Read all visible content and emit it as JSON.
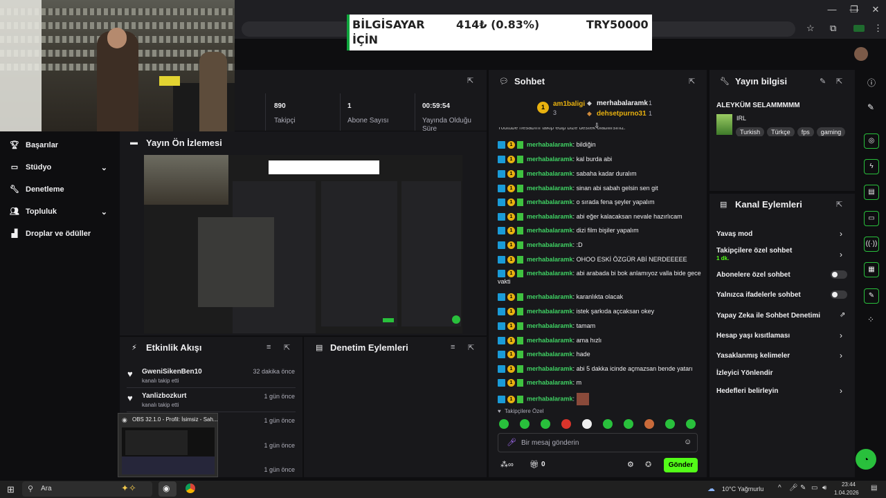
{
  "ticker": {
    "label": "BİLGİSAYAR İÇİN",
    "value": "414₺ (0.83%)",
    "target": "TRY50000"
  },
  "stats": [
    {
      "value": "890",
      "label": "Takipçi"
    },
    {
      "value": "1",
      "label": "Abone Sayısı"
    },
    {
      "value": "00:59:54",
      "label": "Yayında Olduğu Süre"
    }
  ],
  "sidebar": {
    "items": [
      {
        "label": "Başarılar",
        "icon": "trophy-icon"
      },
      {
        "label": "Stüdyo",
        "icon": "studio-icon"
      },
      {
        "label": "Denetleme",
        "icon": "wrench-icon"
      },
      {
        "label": "Topluluk",
        "icon": "community-icon"
      },
      {
        "label": "Droplar ve ödüller",
        "icon": "drops-icon"
      }
    ]
  },
  "preview": {
    "title": "Yayın Ön İzlemesi"
  },
  "events": {
    "title": "Etkinlik Akışı",
    "items": [
      {
        "name": "GweniSikenBen10",
        "action": "kanalı takip etti",
        "time": "32 dakika önce"
      },
      {
        "name": "Yanlizbozkurt",
        "action": "kanalı takip etti",
        "time": "1 gün önce"
      },
      {
        "time": "1 gün önce"
      },
      {
        "time": "1 gün önce"
      },
      {
        "time": "1 gün önce"
      }
    ]
  },
  "moderation": {
    "title": "Denetim Eylemleri"
  },
  "obs_popup": {
    "title": "OBS 32.1.0 - Profil: İsimsiz - Sah..."
  },
  "chat": {
    "title": "Sohbet",
    "leaderboard": [
      {
        "rank": "1",
        "name": "am1baligi",
        "count": "3"
      },
      {
        "name": "merhabalaramk",
        "count": "1"
      },
      {
        "name": "dehsetpurno31",
        "count": "1"
      }
    ],
    "truncated_top": "Youtube hesabını takip edip bize destek olabilirsiniz.",
    "messages": [
      {
        "user": "merhabalaramk",
        "text": "bildiğin"
      },
      {
        "user": "merhabalaramk",
        "text": "kal burda abi"
      },
      {
        "user": "merhabalaramk",
        "text": "sabaha kadar duralım"
      },
      {
        "user": "merhabalaramk",
        "text": "sinan abi sabah gelsin sen git"
      },
      {
        "user": "merhabalaramk",
        "text": "o sırada fena şeyler yapalım"
      },
      {
        "user": "merhabalaramk",
        "text": "abi eğer kalacaksan nevale hazırlıcam"
      },
      {
        "user": "merhabalaramk",
        "text": "dizi film bişiler yapalım"
      },
      {
        "user": "merhabalaramk",
        "text": ":D"
      },
      {
        "user": "merhabalaramk",
        "text": "OHOO ESKİ ÖZGÜR ABİ NERDEEEEE"
      },
      {
        "user": "merhabalaramk",
        "text": "abi arabada bi bok anlamıyoz valla bide gece vakti"
      },
      {
        "user": "merhabalaramk",
        "text": "karanlıkta olacak"
      },
      {
        "user": "merhabalaramk",
        "text": "istek şarkıda açcaksan okey"
      },
      {
        "user": "merhabalaramk",
        "text": "tamam"
      },
      {
        "user": "merhabalaramk",
        "text": "ama hızlı"
      },
      {
        "user": "merhabalaramk",
        "text": "hade"
      },
      {
        "user": "merhabalaramk",
        "text": "abi 5 dakka icinde açmazsan bende yatarı"
      },
      {
        "user": "merhabalaramk",
        "text": "m"
      },
      {
        "user": "merhabalaramk",
        "text": ""
      }
    ],
    "followers_only": "Takipçilere Özel",
    "input_placeholder": "Bir mesaj gönderin",
    "points": "0",
    "send_label": "Gönder"
  },
  "stream_info": {
    "title": "Yayın bilgisi",
    "stream_title": "ALEYKÜM SELAMMMMM",
    "category": "IRL",
    "tags": [
      "Turkish",
      "Türkçe",
      "fps",
      "gaming"
    ]
  },
  "channel_actions": {
    "title": "Kanal Eylemleri",
    "items": [
      {
        "label": "Yavaş mod",
        "type": "chevron"
      },
      {
        "label": "Takipçilere özel sohbet",
        "sub": "1 dk.",
        "type": "chevron"
      },
      {
        "label": "Abonelere özel sohbet",
        "type": "toggle"
      },
      {
        "label": "Yalnızca ifadelerle sohbet",
        "type": "toggle"
      },
      {
        "label": "Yapay Zeka ile Sohbet Denetimi",
        "type": "external"
      },
      {
        "label": "Hesap yaşı kısıtlaması",
        "type": "chevron"
      },
      {
        "label": "Yasaklanmış kelimeler",
        "type": "chevron"
      },
      {
        "label": "İzleyici Yönlendir",
        "type": "none"
      },
      {
        "label": "Hedefleri belirleyin",
        "type": "chevron"
      }
    ]
  },
  "taskbar": {
    "search": "Ara",
    "weather": "10°C Yağmurlu",
    "time": "23:44",
    "date": "1.04.2026"
  },
  "colors": {
    "accent": "#53fc18",
    "panel": "#18181b",
    "bg": "#0e0e10",
    "username": "#3fd163"
  }
}
